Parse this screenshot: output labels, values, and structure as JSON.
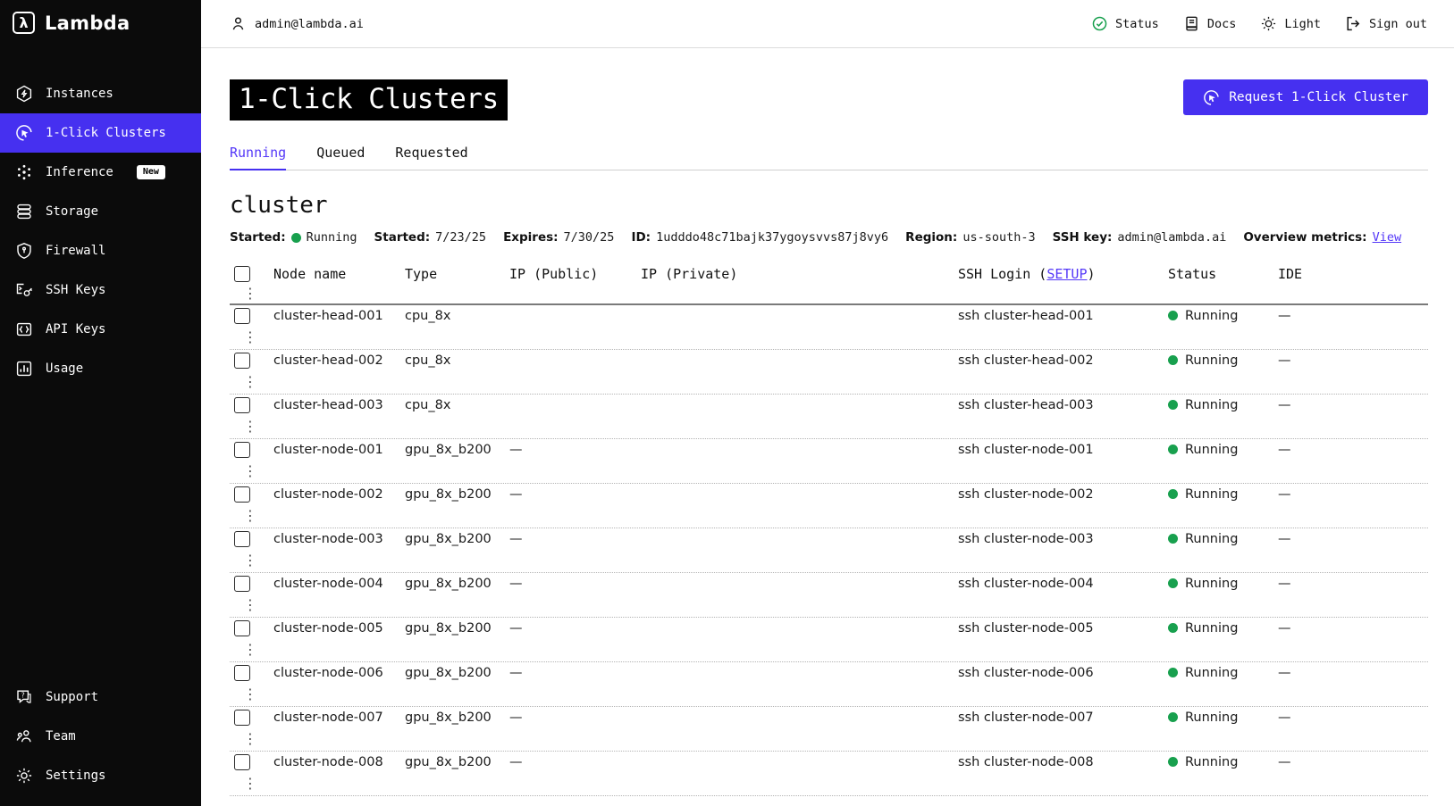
{
  "colors": {
    "accent": "#4630f0",
    "link": "#5438f8",
    "status_green": "#18a04e",
    "sidebar_bg": "#0b0b0b"
  },
  "sidebar": {
    "logo_glyph": "λ",
    "logo_text": "Lambda",
    "items": [
      {
        "label": "Instances",
        "icon": "instances-icon"
      },
      {
        "label": "1-Click Clusters",
        "icon": "one-click-clusters-icon",
        "active": true
      },
      {
        "label": "Inference",
        "icon": "inference-icon",
        "badge": "New"
      },
      {
        "label": "Storage",
        "icon": "storage-icon"
      },
      {
        "label": "Firewall",
        "icon": "firewall-icon"
      },
      {
        "label": "SSH Keys",
        "icon": "ssh-keys-icon"
      },
      {
        "label": "API Keys",
        "icon": "api-keys-icon"
      },
      {
        "label": "Usage",
        "icon": "usage-icon"
      }
    ],
    "footer_items": [
      {
        "label": "Support",
        "icon": "support-icon"
      },
      {
        "label": "Team",
        "icon": "team-icon"
      },
      {
        "label": "Settings",
        "icon": "settings-icon"
      }
    ]
  },
  "topbar": {
    "email": "admin@lambda.ai",
    "actions": [
      {
        "label": "Status",
        "icon": "status-check-icon"
      },
      {
        "label": "Docs",
        "icon": "docs-icon"
      },
      {
        "label": "Light",
        "icon": "theme-icon"
      },
      {
        "label": "Sign out",
        "icon": "sign-out-icon"
      }
    ]
  },
  "page": {
    "title": "1-Click Clusters",
    "request_button": "Request 1-Click Cluster"
  },
  "tabs": [
    {
      "label": "Running",
      "active": true
    },
    {
      "label": "Queued"
    },
    {
      "label": "Requested"
    }
  ],
  "cluster": {
    "name": "cluster",
    "meta": [
      {
        "label": "Started:",
        "value": "Running",
        "dot": true
      },
      {
        "label": "Started:",
        "value": "7/23/25"
      },
      {
        "label": "Expires:",
        "value": "7/30/25"
      },
      {
        "label": "ID:",
        "value": "1udddo48c71bajk37ygoysvvs87j8vy6"
      },
      {
        "label": "Region:",
        "value": "us-south-3"
      },
      {
        "label": "SSH key:",
        "value": "admin@lambda.ai"
      },
      {
        "label": "Overview metrics:",
        "value": "View",
        "link": true
      }
    ]
  },
  "table": {
    "headers": {
      "node_name": "Node name",
      "type": "Type",
      "ip_public": "IP (Public)",
      "ip_private": "IP (Private)",
      "ssh_prefix": "SSH Login (",
      "ssh_link": "SETUP",
      "ssh_suffix": ")",
      "status": "Status",
      "ide": "IDE",
      "kebab": "⋮"
    },
    "rows": [
      {
        "name": "cluster-head-001",
        "type": "cpu_8x",
        "ip_public": "",
        "ip_private": "",
        "ssh": "ssh cluster-head-001",
        "status": "Running",
        "ide": "—",
        "kebab": "⋮"
      },
      {
        "name": "cluster-head-002",
        "type": "cpu_8x",
        "ip_public": "",
        "ip_private": "",
        "ssh": "ssh cluster-head-002",
        "status": "Running",
        "ide": "—",
        "kebab": "⋮"
      },
      {
        "name": "cluster-head-003",
        "type": "cpu_8x",
        "ip_public": "",
        "ip_private": "",
        "ssh": "ssh cluster-head-003",
        "status": "Running",
        "ide": "—",
        "kebab": "⋮"
      },
      {
        "name": "cluster-node-001",
        "type": "gpu_8x_b200",
        "ip_public": "—",
        "ip_private": "",
        "ssh": "ssh cluster-node-001",
        "status": "Running",
        "ide": "—",
        "kebab": "⋮"
      },
      {
        "name": "cluster-node-002",
        "type": "gpu_8x_b200",
        "ip_public": "—",
        "ip_private": "",
        "ssh": "ssh cluster-node-002",
        "status": "Running",
        "ide": "—",
        "kebab": "⋮"
      },
      {
        "name": "cluster-node-003",
        "type": "gpu_8x_b200",
        "ip_public": "—",
        "ip_private": "",
        "ssh": "ssh cluster-node-003",
        "status": "Running",
        "ide": "—",
        "kebab": "⋮"
      },
      {
        "name": "cluster-node-004",
        "type": "gpu_8x_b200",
        "ip_public": "—",
        "ip_private": "",
        "ssh": "ssh cluster-node-004",
        "status": "Running",
        "ide": "—",
        "kebab": "⋮"
      },
      {
        "name": "cluster-node-005",
        "type": "gpu_8x_b200",
        "ip_public": "—",
        "ip_private": "",
        "ssh": "ssh cluster-node-005",
        "status": "Running",
        "ide": "—",
        "kebab": "⋮"
      },
      {
        "name": "cluster-node-006",
        "type": "gpu_8x_b200",
        "ip_public": "—",
        "ip_private": "",
        "ssh": "ssh cluster-node-006",
        "status": "Running",
        "ide": "—",
        "kebab": "⋮"
      },
      {
        "name": "cluster-node-007",
        "type": "gpu_8x_b200",
        "ip_public": "—",
        "ip_private": "",
        "ssh": "ssh cluster-node-007",
        "status": "Running",
        "ide": "—",
        "kebab": "⋮"
      },
      {
        "name": "cluster-node-008",
        "type": "gpu_8x_b200",
        "ip_public": "—",
        "ip_private": "",
        "ssh": "ssh cluster-node-008",
        "status": "Running",
        "ide": "—",
        "kebab": "⋮"
      }
    ]
  }
}
